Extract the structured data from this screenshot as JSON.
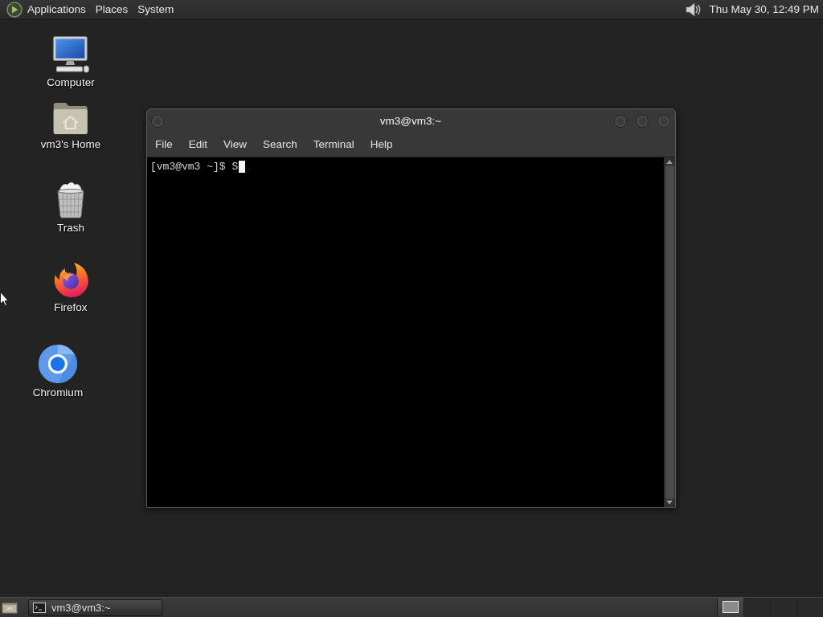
{
  "top_panel": {
    "menus": [
      {
        "label": "Applications"
      },
      {
        "label": "Places"
      },
      {
        "label": "System"
      }
    ],
    "clock": "Thu May 30, 12:49 PM"
  },
  "desktop_icons": [
    {
      "kind": "computer",
      "label": "Computer"
    },
    {
      "kind": "home",
      "label": "vm3's Home"
    },
    {
      "kind": "trash",
      "label": "Trash"
    },
    {
      "kind": "firefox",
      "label": "Firefox"
    },
    {
      "kind": "chromium",
      "label": "Chromium"
    }
  ],
  "terminal_window": {
    "title": "vm3@vm3:~",
    "menu": [
      {
        "label": "File"
      },
      {
        "label": "Edit"
      },
      {
        "label": "View"
      },
      {
        "label": "Search"
      },
      {
        "label": "Terminal"
      },
      {
        "label": "Help"
      }
    ],
    "lines": [
      {
        "text": "[vm3@vm3 ~]$ S",
        "cursor": true
      }
    ]
  },
  "bottom_panel": {
    "tasks": [
      {
        "label": "vm3@vm3:~",
        "selected": true
      }
    ],
    "workspaces": [
      {
        "selected": true,
        "has_window": true
      },
      {
        "selected": false,
        "has_window": false
      },
      {
        "selected": false,
        "has_window": false
      },
      {
        "selected": false,
        "has_window": false
      }
    ]
  }
}
